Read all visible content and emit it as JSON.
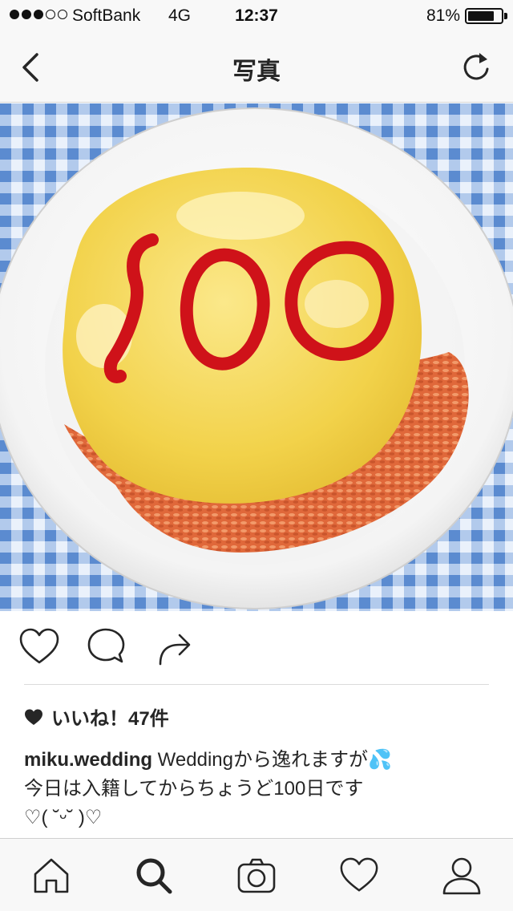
{
  "status_bar": {
    "signal_dots": [
      true,
      true,
      true,
      false,
      false
    ],
    "carrier": "SoftBank",
    "network": "4G",
    "time": "12:37",
    "battery_percent": "81%",
    "battery_level": 0.81
  },
  "nav": {
    "title": "写真",
    "back_icon": "chevron-left-icon",
    "refresh_icon": "refresh-icon"
  },
  "photo": {
    "ketchup_text": "100"
  },
  "actions": {
    "icons": [
      "heart-outline-icon",
      "comment-bubble-icon",
      "share-arrow-icon"
    ]
  },
  "likes": {
    "text": "いいね！47件"
  },
  "caption": {
    "username": "miku.wedding",
    "line1": " Weddingから逸れますが💦",
    "line2": "今日は入籍してからちょうど100日です",
    "line3": "♡( ˘ᵕ˘ )♡"
  },
  "tab_bar": {
    "items": [
      "home-icon",
      "search-icon",
      "camera-icon",
      "activity-heart-icon",
      "profile-icon"
    ],
    "active": "search-icon"
  },
  "colors": {
    "text": "#262626",
    "bar_bg": "#f8f8f8",
    "ketchup": "#d0141c",
    "egg": "#f3d652",
    "rice": "#e26c3c",
    "checker": "#7aa4d8"
  }
}
